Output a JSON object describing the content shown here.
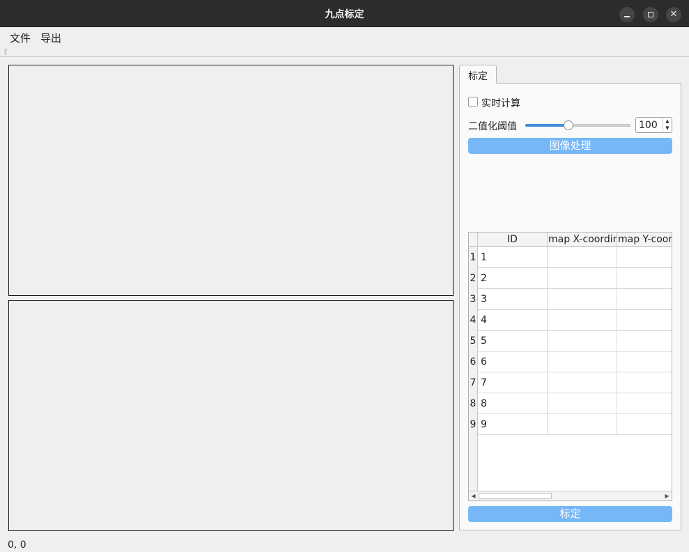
{
  "window": {
    "title": "九点标定"
  },
  "menu": {
    "file": "文件",
    "export": "导出"
  },
  "tab": {
    "label": "标定"
  },
  "controls": {
    "realtime_label": "实时计算",
    "realtime_checked": false,
    "threshold_label": "二值化阈值",
    "threshold_value": "100",
    "threshold_slider_fraction": 0.4,
    "process_button": "图像处理",
    "calibrate_button": "标定"
  },
  "table": {
    "columns": [
      "ID",
      "map X-coordin",
      "map Y-coord"
    ],
    "rows": [
      {
        "num": "1",
        "id": "1",
        "x": "",
        "y": ""
      },
      {
        "num": "2",
        "id": "2",
        "x": "",
        "y": ""
      },
      {
        "num": "3",
        "id": "3",
        "x": "",
        "y": ""
      },
      {
        "num": "4",
        "id": "4",
        "x": "",
        "y": ""
      },
      {
        "num": "5",
        "id": "5",
        "x": "",
        "y": ""
      },
      {
        "num": "6",
        "id": "6",
        "x": "",
        "y": ""
      },
      {
        "num": "7",
        "id": "7",
        "x": "",
        "y": ""
      },
      {
        "num": "8",
        "id": "8",
        "x": "",
        "y": ""
      },
      {
        "num": "9",
        "id": "9",
        "x": "",
        "y": ""
      }
    ]
  },
  "status": {
    "coords": "0, 0"
  },
  "colors": {
    "accent": "#75b7f7",
    "slider_fill": "#3d8fd6"
  }
}
